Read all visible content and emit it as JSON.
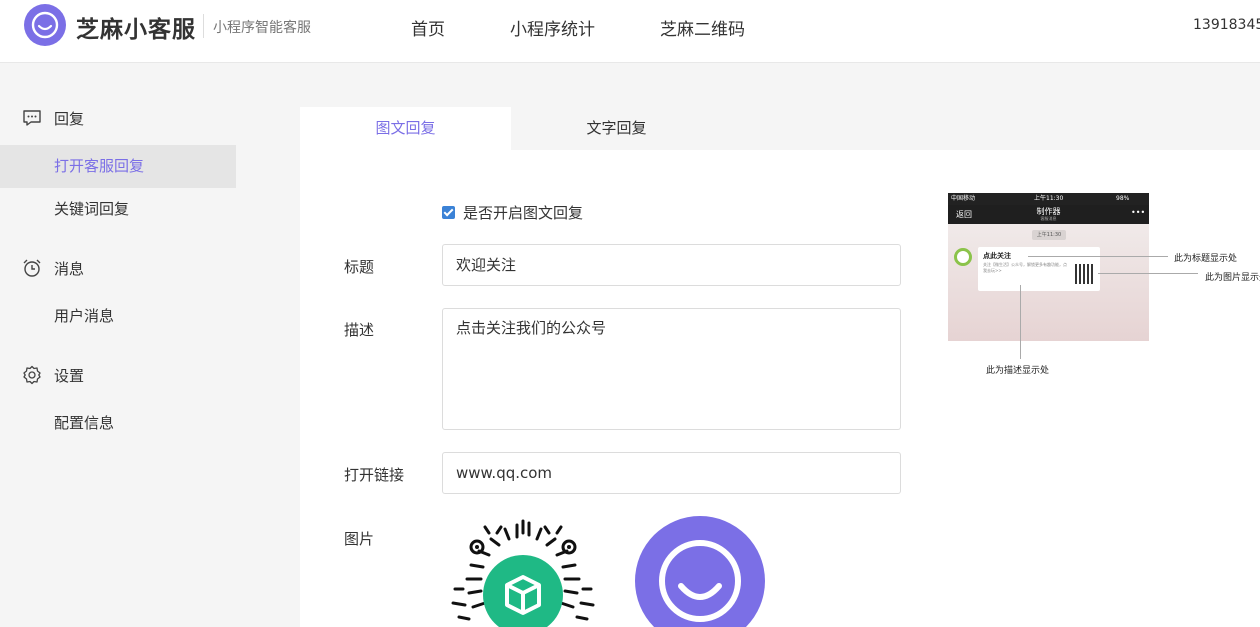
{
  "header": {
    "brand": "芝麻小客服",
    "subtitle": "小程序智能客服",
    "nav": [
      "首页",
      "小程序统计",
      "芝麻二维码"
    ],
    "user": "13918345"
  },
  "sidebar": {
    "groups": [
      {
        "label": "回复",
        "icon": "chat-bubble-icon",
        "items": [
          "打开客服回复",
          "关键词回复"
        ]
      },
      {
        "label": "消息",
        "icon": "alarm-clock-icon",
        "items": [
          "用户消息"
        ]
      },
      {
        "label": "设置",
        "icon": "gear-icon",
        "items": [
          "配置信息"
        ]
      }
    ],
    "active_item": "打开客服回复"
  },
  "tabs": [
    "图文回复",
    "文字回复"
  ],
  "active_tab": "图文回复",
  "form": {
    "enable_label": "是否开启图文回复",
    "enabled": true,
    "title_label": "标题",
    "title_value": "欢迎关注",
    "desc_label": "描述",
    "desc_value": "点击关注我们的公众号",
    "link_label": "打开链接",
    "link_value": "www.qq.com",
    "image_label": "图片"
  },
  "preview": {
    "status_left": "中国移动",
    "status_time": "上午11:30",
    "status_right": "98%",
    "back": "返回",
    "nav_title": "制作器",
    "nav_subtitle": "客服消息",
    "more": "•••",
    "time_badge": "上午11:30",
    "card_title": "点此关注",
    "card_desc": "关注【微生活】公众号，解锁更多有趣功能，点我去玩>>",
    "annotation_title": "此为标题显示处",
    "annotation_image": "此为图片显示处",
    "annotation_desc": "此为描述显示处"
  },
  "colors": {
    "accent": "#7b6fe6",
    "checkbox": "#3b82d6",
    "qr_center": "#1fb985"
  }
}
